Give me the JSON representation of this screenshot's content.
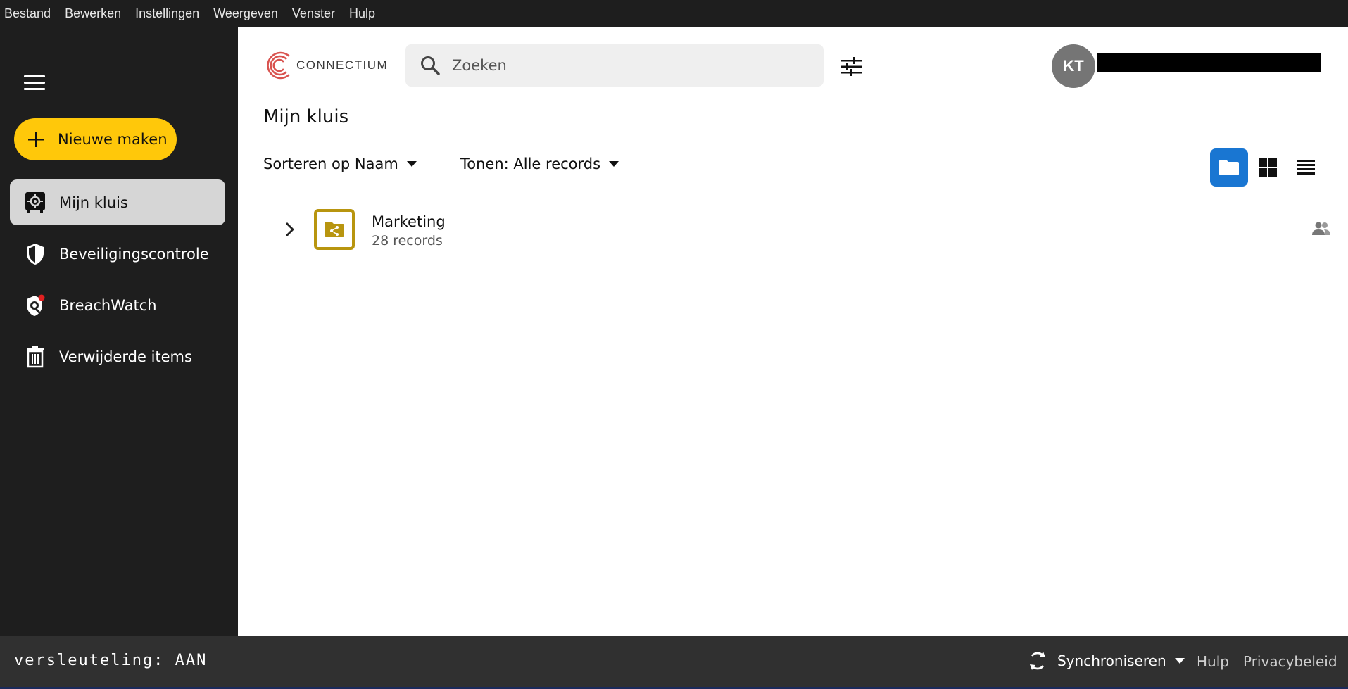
{
  "menubar": {
    "items": [
      "Bestand",
      "Bewerken",
      "Instellingen",
      "Weergeven",
      "Venster",
      "Hulp"
    ]
  },
  "sidebar": {
    "new_button_label": "Nieuwe maken",
    "items": [
      {
        "label": "Mijn kluis",
        "icon": "vault-icon",
        "active": true
      },
      {
        "label": "Beveiligingscontrole",
        "icon": "shield-icon",
        "active": false
      },
      {
        "label": "BreachWatch",
        "icon": "breachwatch-icon",
        "active": false
      },
      {
        "label": "Verwijderde items",
        "icon": "trash-icon",
        "active": false
      }
    ]
  },
  "header": {
    "brand": "CONNECTIUM",
    "search_placeholder": "Zoeken",
    "avatar_initials": "KT"
  },
  "main": {
    "title": "Mijn kluis",
    "sort_label": "Sorteren op Naam",
    "show_label": "Tonen: Alle records",
    "folders": [
      {
        "name": "Marketing",
        "count": "28 records"
      }
    ]
  },
  "footer": {
    "encryption": "versleuteling: AAN",
    "sync_label": "Synchroniseren",
    "help_link": "Hulp",
    "privacy_link": "Privacybeleid"
  },
  "colors": {
    "accent_yellow": "#ffc80a",
    "view_active": "#1976d2",
    "folder_gold": "#b8950f",
    "sidebar_bg": "#1e1e1e",
    "footer_bg": "#303030"
  }
}
